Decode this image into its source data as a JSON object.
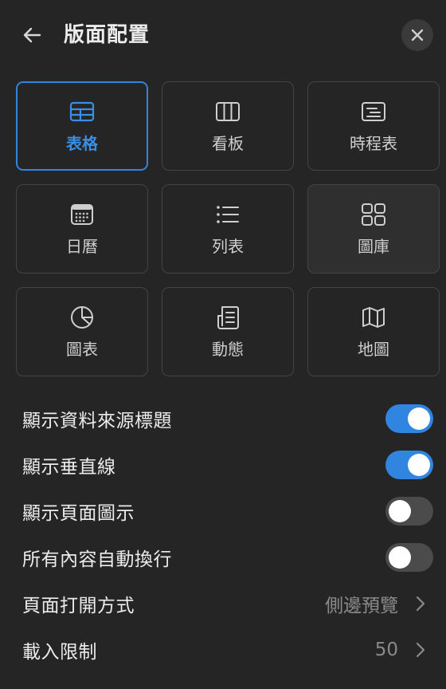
{
  "header": {
    "title": "版面配置",
    "back_icon": "arrow-left-icon",
    "close_icon": "close-icon"
  },
  "layouts": [
    {
      "label": "表格",
      "icon": "table-icon",
      "selected": true
    },
    {
      "label": "看板",
      "icon": "board-icon",
      "selected": false
    },
    {
      "label": "時程表",
      "icon": "timeline-icon",
      "selected": false
    },
    {
      "label": "日曆",
      "icon": "calendar-icon",
      "selected": false
    },
    {
      "label": "列表",
      "icon": "list-icon",
      "selected": false
    },
    {
      "label": "圖庫",
      "icon": "gallery-icon",
      "selected": false
    },
    {
      "label": "圖表",
      "icon": "pie-chart-icon",
      "selected": false
    },
    {
      "label": "動態",
      "icon": "feed-icon",
      "selected": false
    },
    {
      "label": "地圖",
      "icon": "map-icon",
      "selected": false
    }
  ],
  "settings": {
    "show_source_title": {
      "label": "顯示資料來源標題",
      "on": true
    },
    "show_vertical_lines": {
      "label": "顯示垂直線",
      "on": true
    },
    "show_page_icon": {
      "label": "顯示頁面圖示",
      "on": false
    },
    "wrap_all_content": {
      "label": "所有內容自動換行",
      "on": false
    },
    "open_pages_in": {
      "label": "頁面打開方式",
      "value": "側邊預覽"
    },
    "load_limit": {
      "label": "載入限制",
      "value": "50"
    }
  },
  "colors": {
    "accent": "#2f85e0",
    "background": "#252525",
    "border": "#444444",
    "muted_text": "#8a8a8a"
  }
}
